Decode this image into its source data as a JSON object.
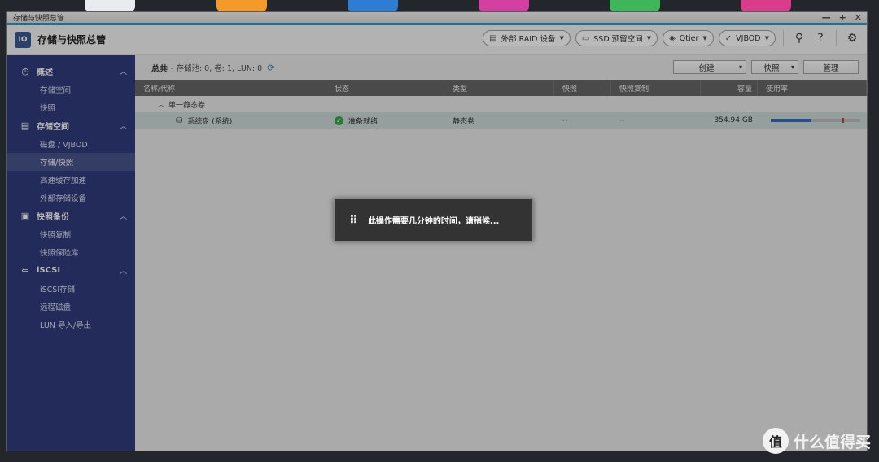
{
  "window": {
    "title": "存储与快照总管",
    "controls": [
      "—",
      "+",
      "✕"
    ]
  },
  "header": {
    "app_title": "存储与快照总管",
    "app_logo_text": "IO",
    "tools": [
      {
        "label": "外部 RAID 设备",
        "icon": "▤"
      },
      {
        "label": "SSD 预留空间",
        "icon": "▭"
      },
      {
        "label": "Qtier",
        "icon": "◈"
      },
      {
        "label": "VJBOD",
        "icon": "✓"
      }
    ],
    "search_icon": "⚲",
    "help_icon": "?",
    "settings_icon": "⚙"
  },
  "sidebar": {
    "groups": [
      {
        "label": "概述",
        "icon": "◷",
        "items": [
          "存储空间",
          "快照"
        ]
      },
      {
        "label": "存储空间",
        "icon": "▤",
        "items": [
          "磁盘 / VJBOD",
          "存储/快照",
          "高速缓存加速",
          "外部存储设备"
        ]
      },
      {
        "label": "快照备份",
        "icon": "▣",
        "items": [
          "快照复制",
          "快照保险库"
        ]
      },
      {
        "label": "iSCSI",
        "icon": "⇦",
        "items": [
          "iSCSI存储",
          "远程磁盘",
          "LUN 导入/导出"
        ]
      }
    ],
    "active_item": "存储/快照"
  },
  "summary": {
    "label": "总共",
    "text": "- 存储池: 0, 卷: 1, LUN: 0"
  },
  "actions": {
    "create": "创建",
    "snapshot": "快照",
    "manage": "管理"
  },
  "table": {
    "columns": [
      "名称/代称",
      "状态",
      "类型",
      "快照",
      "快照复制",
      "容量",
      "使用率"
    ],
    "group_label": "单一静态卷",
    "rows": [
      {
        "name": "系统盘 (系统)",
        "status": "准备就绪",
        "type": "静态卷",
        "snapshot": "--",
        "replication": "--",
        "capacity": "354.94 GB",
        "usage_pct": 45
      }
    ]
  },
  "toast": {
    "message": "此操作需要几分钟的时间，请稍候..."
  },
  "watermark": {
    "logo": "值",
    "text": "什么值得买"
  },
  "colors": {
    "sidebar": "#1f2d72",
    "accent": "#1e8fc6",
    "usage": "#2b5db8"
  }
}
